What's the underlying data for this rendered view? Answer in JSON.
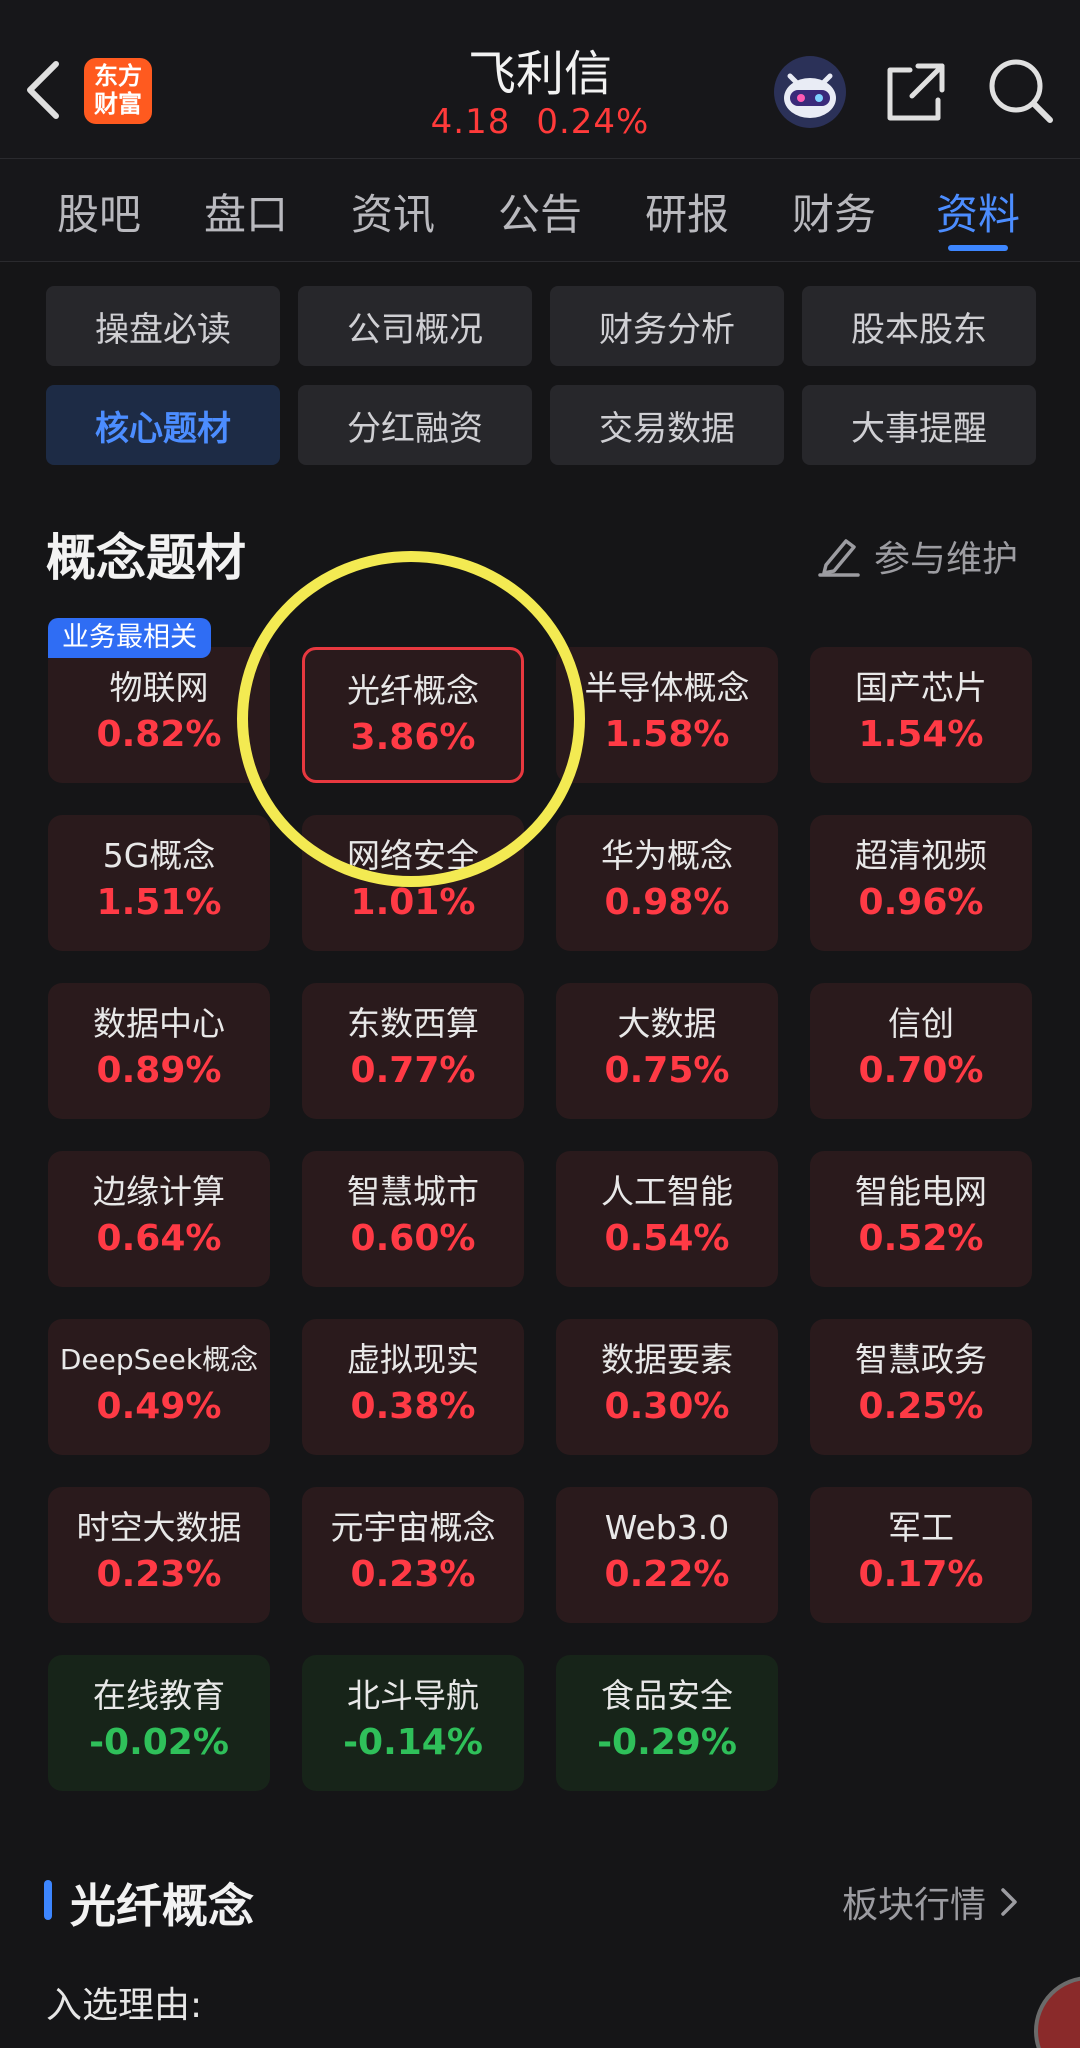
{
  "header": {
    "logo_line1": "东方",
    "logo_line2": "财富",
    "stock_name": "飞利信",
    "price": "4.18",
    "change_pct": "0.24%",
    "icons": [
      "chevron-left-icon",
      "robot-avatar-icon",
      "share-icon",
      "search-icon"
    ]
  },
  "tabs": [
    "股吧",
    "盘口",
    "资讯",
    "公告",
    "研报",
    "财务",
    "资料"
  ],
  "active_tab": "资料",
  "submenu": [
    [
      "操盘必读",
      "公司概况",
      "财务分析",
      "股本股东"
    ],
    [
      "核心题材",
      "分红融资",
      "交易数据",
      "大事提醒"
    ]
  ],
  "active_submenu": "核心题材",
  "concepts": {
    "title": "概念题材",
    "maintain_label": "参与维护",
    "tag": "业务最相关",
    "selected": "光纤概念",
    "items": [
      {
        "name": "物联网",
        "change": "0.82%",
        "dir": "up"
      },
      {
        "name": "光纤概念",
        "change": "3.86%",
        "dir": "up"
      },
      {
        "name": "半导体概念",
        "change": "1.58%",
        "dir": "up"
      },
      {
        "name": "国产芯片",
        "change": "1.54%",
        "dir": "up"
      },
      {
        "name": "5G概念",
        "change": "1.51%",
        "dir": "up"
      },
      {
        "name": "网络安全",
        "change": "1.01%",
        "dir": "up"
      },
      {
        "name": "华为概念",
        "change": "0.98%",
        "dir": "up"
      },
      {
        "name": "超清视频",
        "change": "0.96%",
        "dir": "up"
      },
      {
        "name": "数据中心",
        "change": "0.89%",
        "dir": "up"
      },
      {
        "name": "东数西算",
        "change": "0.77%",
        "dir": "up"
      },
      {
        "name": "大数据",
        "change": "0.75%",
        "dir": "up"
      },
      {
        "name": "信创",
        "change": "0.70%",
        "dir": "up"
      },
      {
        "name": "边缘计算",
        "change": "0.64%",
        "dir": "up"
      },
      {
        "name": "智慧城市",
        "change": "0.60%",
        "dir": "up"
      },
      {
        "name": "人工智能",
        "change": "0.54%",
        "dir": "up"
      },
      {
        "name": "智能电网",
        "change": "0.52%",
        "dir": "up"
      },
      {
        "name": "DeepSeek概念",
        "change": "0.49%",
        "dir": "up"
      },
      {
        "name": "虚拟现实",
        "change": "0.38%",
        "dir": "up"
      },
      {
        "name": "数据要素",
        "change": "0.30%",
        "dir": "up"
      },
      {
        "name": "智慧政务",
        "change": "0.25%",
        "dir": "up"
      },
      {
        "name": "时空大数据",
        "change": "0.23%",
        "dir": "up"
      },
      {
        "name": "元宇宙概念",
        "change": "0.23%",
        "dir": "up"
      },
      {
        "name": "Web3.0",
        "change": "0.22%",
        "dir": "up"
      },
      {
        "name": "军工",
        "change": "0.17%",
        "dir": "up"
      },
      {
        "name": "在线教育",
        "change": "-0.02%",
        "dir": "down"
      },
      {
        "name": "北斗导航",
        "change": "-0.14%",
        "dir": "down"
      },
      {
        "name": "食品安全",
        "change": "-0.29%",
        "dir": "down"
      }
    ]
  },
  "detail": {
    "title": "光纤概念",
    "link_label": "板块行情",
    "reason_label": "入选理由:"
  },
  "colors": {
    "up": "#ff3a45",
    "down": "#2fc05a",
    "accent": "#3d86ff",
    "highlight": "#f3ea52"
  }
}
